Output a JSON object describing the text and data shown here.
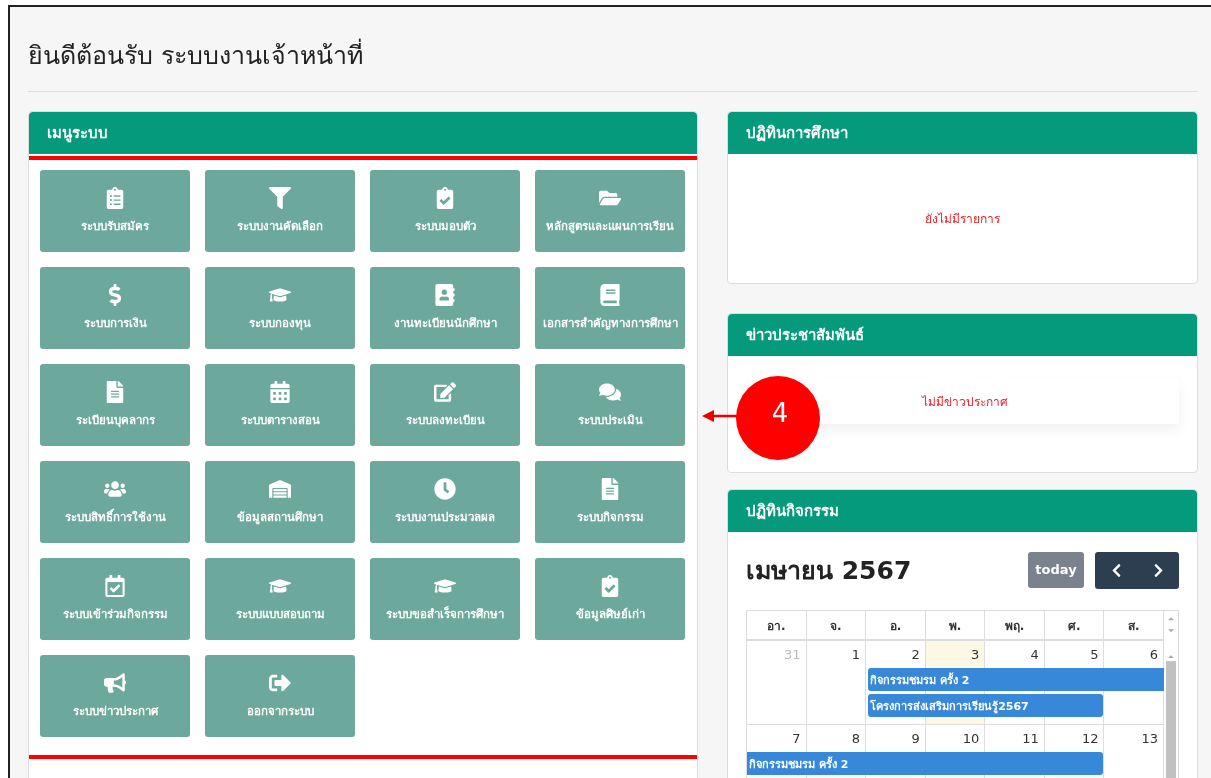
{
  "page_title": "ยินดีต้อนรับ ระบบงานเจ้าหน้าที่",
  "menu_panel": {
    "title": "เมนูระบบ",
    "items": [
      {
        "label": "ระบบรับสมัคร"
      },
      {
        "label": "ระบบงานคัดเลือก"
      },
      {
        "label": "ระบบมอบตัว"
      },
      {
        "label": "หลักสูตรและแผนการเรียน"
      },
      {
        "label": "ระบบการเงิน"
      },
      {
        "label": "ระบบกองทุน"
      },
      {
        "label": "งานทะเบียนนักศึกษา"
      },
      {
        "label": "เอกสารสำคัญทางการศึกษา"
      },
      {
        "label": "ระเบียนบุคลากร"
      },
      {
        "label": "ระบบตารางสอน"
      },
      {
        "label": "ระบบลงทะเบียน"
      },
      {
        "label": "ระบบประเมิน"
      },
      {
        "label": "ระบบสิทธิ์การใช้งาน"
      },
      {
        "label": "ข้อมูลสถานศึกษา"
      },
      {
        "label": "ระบบงานประมวลผล"
      },
      {
        "label": "ระบบกิจกรรม"
      },
      {
        "label": "ระบบเข้าร่วมกิจกรรม"
      },
      {
        "label": "ระบบแบบสอบถาม"
      },
      {
        "label": "ระบบขอสำเร็จการศึกษา"
      },
      {
        "label": "ข้อมูลศิษย์เก่า"
      },
      {
        "label": "ระบบข่าวประกาศ"
      },
      {
        "label": "ออกจากระบบ"
      }
    ]
  },
  "annotation": {
    "number": "4"
  },
  "academic_calendar": {
    "title": "ปฏิทินการศึกษา",
    "message": "ยังไม่มีรายการ"
  },
  "news": {
    "title": "ข่าวประชาสัมพันธ์",
    "message": "ไม่มีข่าวประกาศ"
  },
  "activity_calendar": {
    "title": "ปฏิทินกิจกรรม",
    "month": "เมษายน 2567",
    "today_button": "today",
    "weekdays": [
      "อา.",
      "จ.",
      "อ.",
      "พ.",
      "พฤ.",
      "ศ.",
      "ส."
    ],
    "weeks": [
      {
        "days": [
          {
            "label": "31",
            "other_month": true,
            "today": false
          },
          {
            "label": "1",
            "other_month": false,
            "today": false
          },
          {
            "label": "2",
            "other_month": false,
            "today": false
          },
          {
            "label": "3",
            "other_month": false,
            "today": true
          },
          {
            "label": "4",
            "other_month": false,
            "today": false
          },
          {
            "label": "5",
            "other_month": false,
            "today": false
          },
          {
            "label": "6",
            "other_month": false,
            "today": false
          }
        ],
        "events": [
          {
            "title": "กิจกรรมชมรม ครั้ง 2"
          },
          {
            "title": "โครงการส่งเสริมการเรียนรู้2567"
          }
        ]
      },
      {
        "days": [
          {
            "label": "7",
            "other_month": false,
            "today": false
          },
          {
            "label": "8",
            "other_month": false,
            "today": false
          },
          {
            "label": "9",
            "other_month": false,
            "today": false
          },
          {
            "label": "10",
            "other_month": false,
            "today": false
          },
          {
            "label": "11",
            "other_month": false,
            "today": false
          },
          {
            "label": "12",
            "other_month": false,
            "today": false
          },
          {
            "label": "13",
            "other_month": false,
            "today": false
          }
        ],
        "events": [
          {
            "title": "กิจกรรมชมรม ครั้ง 2"
          }
        ]
      }
    ]
  }
}
